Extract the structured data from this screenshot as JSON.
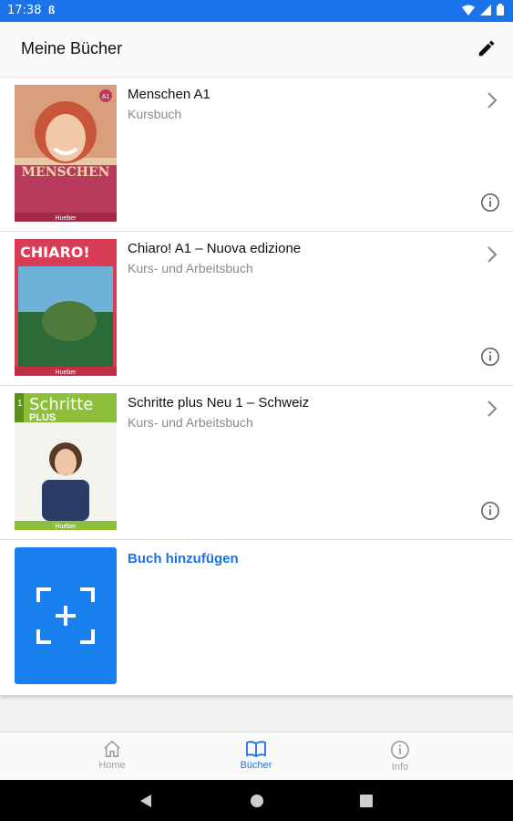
{
  "status": {
    "time": "17:38",
    "data_icon": "ß"
  },
  "appbar": {
    "title": "Meine Bücher",
    "edit_icon": "pencil-icon"
  },
  "books": [
    {
      "title": "Menschen A1",
      "subtitle": "Kursbuch",
      "cover_text": "MENSCHEN",
      "cover_badge": "A1",
      "publisher": "Hueber"
    },
    {
      "title": "Chiaro! A1 – Nuova edizione",
      "subtitle": "Kurs- und Arbeitsbuch",
      "cover_text": "CHIARO!",
      "publisher": "Hueber"
    },
    {
      "title": "Schritte plus Neu 1 – Schweiz",
      "subtitle": "Kurs- und Arbeitsbuch",
      "cover_text": "Schritte",
      "cover_text2": "PLUS",
      "cover_number": "1",
      "publisher": "Hueber"
    }
  ],
  "add_book": {
    "label": "Buch hinzufügen"
  },
  "nav": [
    {
      "label": "Home",
      "icon": "home-icon"
    },
    {
      "label": "Bücher",
      "icon": "book-icon",
      "active": true
    },
    {
      "label": "Info",
      "icon": "info-icon"
    }
  ],
  "colors": {
    "accent": "#1a73e8",
    "statusbar": "#1a73e8"
  }
}
